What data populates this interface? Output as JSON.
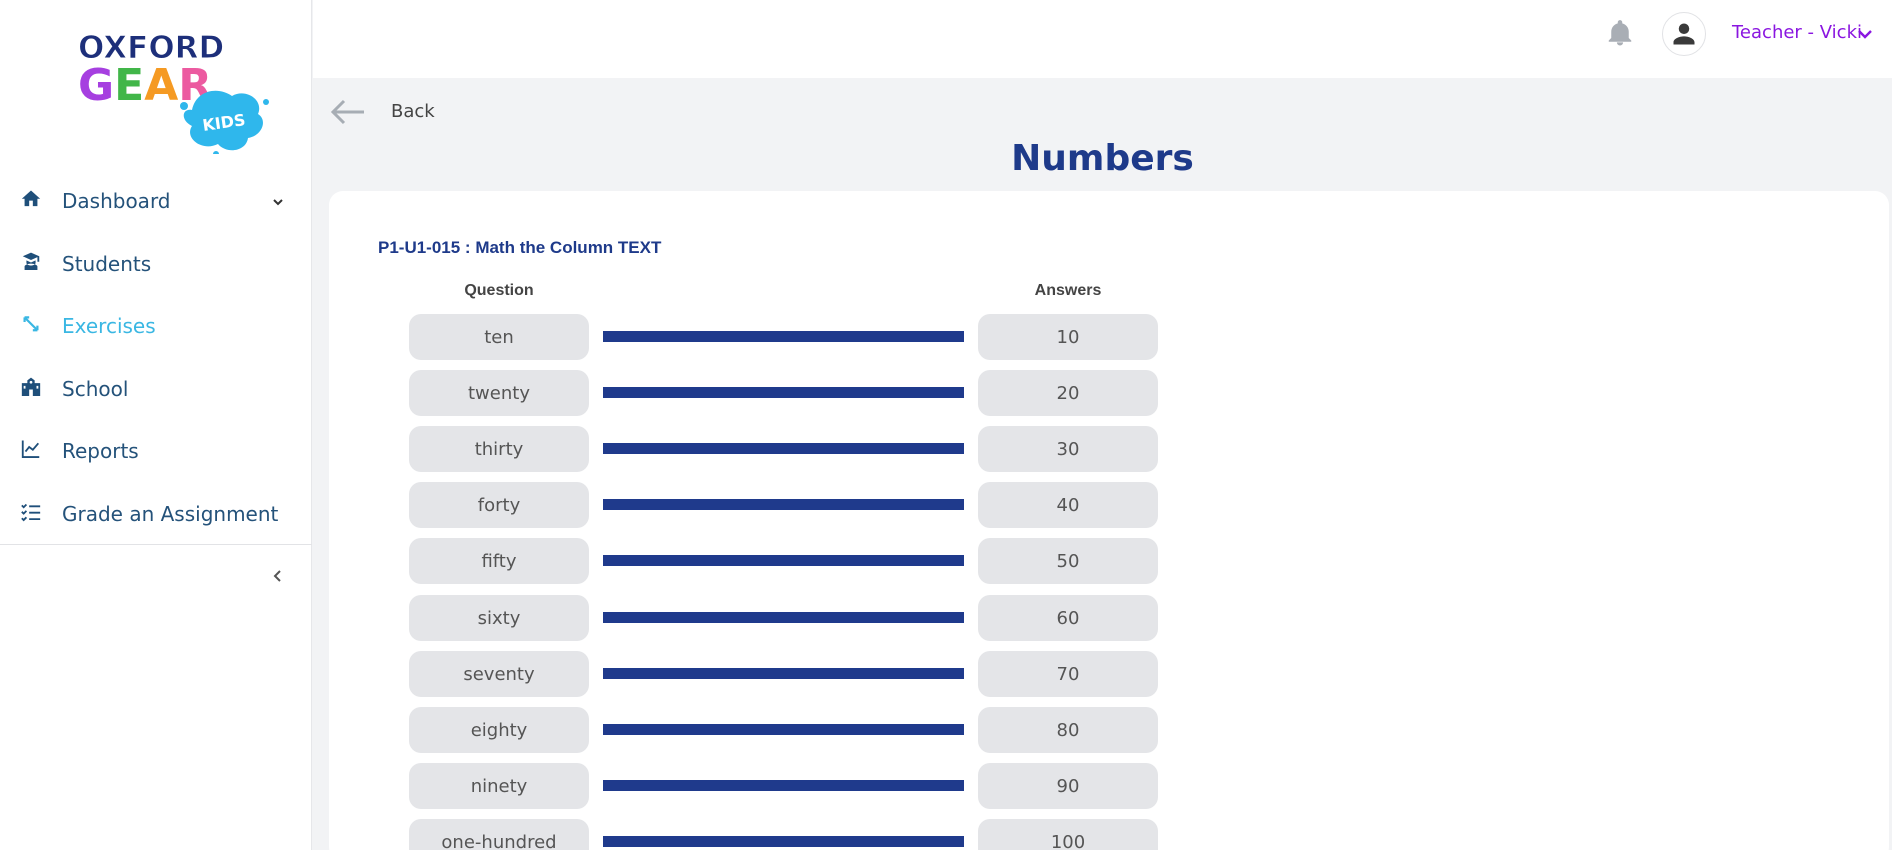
{
  "logo": {
    "line1": "OXFORD",
    "line2": "GEAR",
    "badge": "KIDS"
  },
  "sidebar": {
    "items": [
      {
        "label": "Dashboard",
        "icon": "home-icon",
        "has_submenu": true,
        "active": false
      },
      {
        "label": "Students",
        "icon": "student-icon",
        "active": false
      },
      {
        "label": "Exercises",
        "icon": "exercises-icon",
        "active": true
      },
      {
        "label": "School",
        "icon": "school-icon",
        "active": false
      },
      {
        "label": "Reports",
        "icon": "chart-line-icon",
        "active": false
      },
      {
        "label": "Grade an Assignment",
        "icon": "checklist-icon",
        "active": false
      }
    ]
  },
  "header": {
    "user_label": "Teacher - Vicki"
  },
  "back_label": "Back",
  "page_title": "Numbers",
  "exercise": {
    "title": "P1-U1-015 : Math the Column TEXT",
    "question_header": "Question",
    "answer_header": "Answers",
    "pairs": [
      {
        "question": "ten",
        "answer": "10"
      },
      {
        "question": "twenty",
        "answer": "20"
      },
      {
        "question": "thirty",
        "answer": "30"
      },
      {
        "question": "forty",
        "answer": "40"
      },
      {
        "question": "fifty",
        "answer": "50"
      },
      {
        "question": "sixty",
        "answer": "60"
      },
      {
        "question": "seventy",
        "answer": "70"
      },
      {
        "question": "eighty",
        "answer": "80"
      },
      {
        "question": "ninety",
        "answer": "90"
      },
      {
        "question": "one-hundred",
        "answer": "100"
      }
    ]
  },
  "colors": {
    "primary_navy": "#1e3a8a",
    "active_nav": "#3ab7e3",
    "user_purple": "#8a16e0",
    "pill_bg": "#e4e5e8"
  }
}
